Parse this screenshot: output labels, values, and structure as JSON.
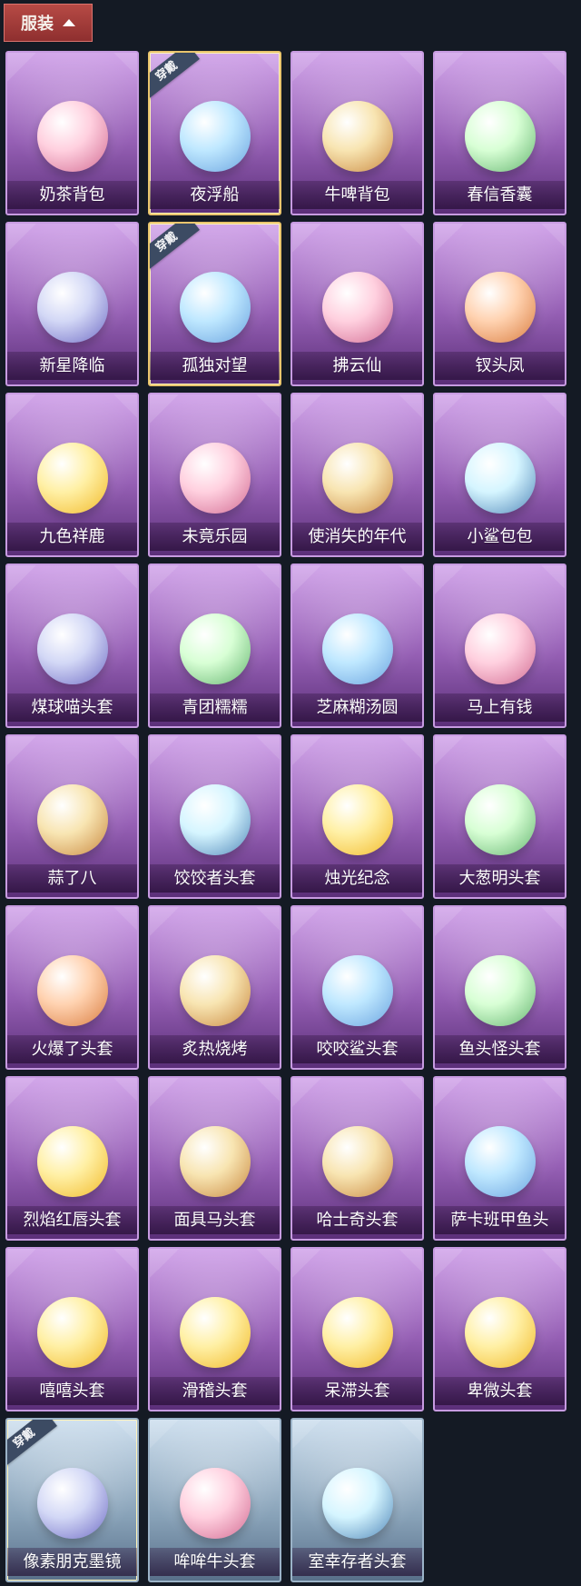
{
  "header": {
    "title": "服装"
  },
  "items": [
    {
      "label": "奶茶背包",
      "tag": "",
      "theme": "purple",
      "thumb": "style-b"
    },
    {
      "label": "夜浮船",
      "tag": "穿戴",
      "theme": "purple",
      "thumb": "style-a"
    },
    {
      "label": "牛啤背包",
      "tag": "",
      "theme": "purple",
      "thumb": "style-d"
    },
    {
      "label": "春信香囊",
      "tag": "",
      "theme": "purple",
      "thumb": "style-c"
    },
    {
      "label": "新星降临",
      "tag": "",
      "theme": "purple",
      "thumb": "style-e"
    },
    {
      "label": "孤独对望",
      "tag": "穿戴",
      "theme": "purple",
      "thumb": "style-a"
    },
    {
      "label": "拂云仙",
      "tag": "",
      "theme": "purple",
      "thumb": "style-b"
    },
    {
      "label": "钗头凤",
      "tag": "",
      "theme": "purple",
      "thumb": "style-g"
    },
    {
      "label": "九色祥鹿",
      "tag": "",
      "theme": "purple",
      "thumb": "style-f"
    },
    {
      "label": "未竟乐园",
      "tag": "",
      "theme": "purple",
      "thumb": "style-b"
    },
    {
      "label": "使消失的年代",
      "tag": "",
      "theme": "purple",
      "thumb": "style-d"
    },
    {
      "label": "小鲨包包",
      "tag": "",
      "theme": "purple",
      "thumb": "style-h"
    },
    {
      "label": "煤球喵头套",
      "tag": "",
      "theme": "purple",
      "thumb": "style-e"
    },
    {
      "label": "青团糯糯",
      "tag": "",
      "theme": "purple",
      "thumb": "style-c"
    },
    {
      "label": "芝麻糊汤圆",
      "tag": "",
      "theme": "purple",
      "thumb": "style-a"
    },
    {
      "label": "马上有钱",
      "tag": "",
      "theme": "purple",
      "thumb": "style-b"
    },
    {
      "label": "蒜了八",
      "tag": "",
      "theme": "purple",
      "thumb": "style-d"
    },
    {
      "label": "饺饺者头套",
      "tag": "",
      "theme": "purple",
      "thumb": "style-h"
    },
    {
      "label": "烛光纪念",
      "tag": "",
      "theme": "purple",
      "thumb": "style-f"
    },
    {
      "label": "大葱明头套",
      "tag": "",
      "theme": "purple",
      "thumb": "style-c"
    },
    {
      "label": "火爆了头套",
      "tag": "",
      "theme": "purple",
      "thumb": "style-g"
    },
    {
      "label": "炙热烧烤",
      "tag": "",
      "theme": "purple",
      "thumb": "style-d"
    },
    {
      "label": "咬咬鲨头套",
      "tag": "",
      "theme": "purple",
      "thumb": "style-a"
    },
    {
      "label": "鱼头怪头套",
      "tag": "",
      "theme": "purple",
      "thumb": "style-c"
    },
    {
      "label": "烈焰红唇头套",
      "tag": "",
      "theme": "purple",
      "thumb": "style-f"
    },
    {
      "label": "面具马头套",
      "tag": "",
      "theme": "purple",
      "thumb": "style-d"
    },
    {
      "label": "哈士奇头套",
      "tag": "",
      "theme": "purple",
      "thumb": "style-d"
    },
    {
      "label": "萨卡班甲鱼头",
      "tag": "",
      "theme": "purple",
      "thumb": "style-a"
    },
    {
      "label": "嘻嘻头套",
      "tag": "",
      "theme": "purple",
      "thumb": "style-f"
    },
    {
      "label": "滑稽头套",
      "tag": "",
      "theme": "purple",
      "thumb": "style-f"
    },
    {
      "label": "呆滞头套",
      "tag": "",
      "theme": "purple",
      "thumb": "style-f"
    },
    {
      "label": "卑微头套",
      "tag": "",
      "theme": "purple",
      "thumb": "style-f"
    },
    {
      "label": "像素朋克墨镜",
      "tag": "穿戴",
      "theme": "blue",
      "thumb": "style-e"
    },
    {
      "label": "哞哞牛头套",
      "tag": "",
      "theme": "blue",
      "thumb": "style-b"
    },
    {
      "label": "室幸存者头套",
      "tag": "",
      "theme": "blue",
      "thumb": "style-h"
    }
  ]
}
